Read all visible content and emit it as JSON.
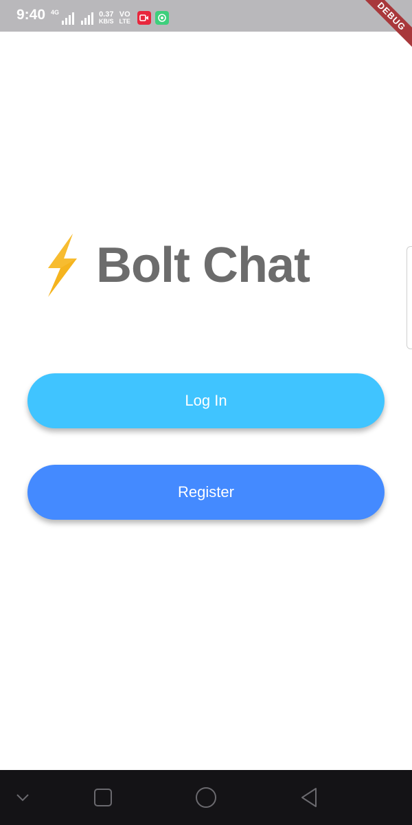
{
  "status_bar": {
    "time": "9:40",
    "network_small": "4G",
    "speed_value": "0.37",
    "speed_unit": "KB/S",
    "volte_top": "VO",
    "volte_bottom": "LTE",
    "debug_label": "DEBUG",
    "background_color": "#b9b8bb"
  },
  "logo": {
    "icon": "lightning-bolt-icon",
    "title": "Bolt Chat",
    "bolt_color": "#f5b41e",
    "title_color": "#6c6c6c"
  },
  "buttons": {
    "login_label": "Log In",
    "login_color": "#40c4ff",
    "register_label": "Register",
    "register_color": "#448aff"
  },
  "nav_bar": {
    "items": [
      "chevron-down-icon",
      "square-recents-icon",
      "circle-home-icon",
      "triangle-back-icon"
    ]
  }
}
